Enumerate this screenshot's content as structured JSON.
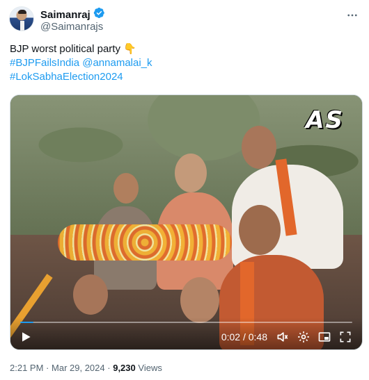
{
  "author": {
    "display_name": "Saimanraj",
    "handle": "@Saimanrajs",
    "verified": true,
    "avatar_icon": "profile-avatar"
  },
  "more_icon": "more-horizontal-icon",
  "tweet": {
    "line1_text": "BJP worst political party",
    "line1_emoji": "👇",
    "hashtag1": "#BJPFailsIndia",
    "mention1": "@annamalai_k",
    "hashtag2": "#LokSabhaElection2024"
  },
  "video": {
    "watermark": "AS",
    "time_display": "0:02 / 0:48",
    "progress": 0.04,
    "accent_color": "#1d9bf0",
    "icons": [
      "play-icon",
      "volume-icon",
      "settings-icon",
      "pip-icon",
      "fullscreen-icon"
    ]
  },
  "meta": {
    "time": "2:21 PM",
    "separator": "·",
    "date": "Mar 29, 2024",
    "views_count": "9,230",
    "views_label": "Views"
  },
  "colors": {
    "link": "#1d9bf0",
    "secondary_text": "#536471",
    "primary_text": "#0f1419"
  }
}
